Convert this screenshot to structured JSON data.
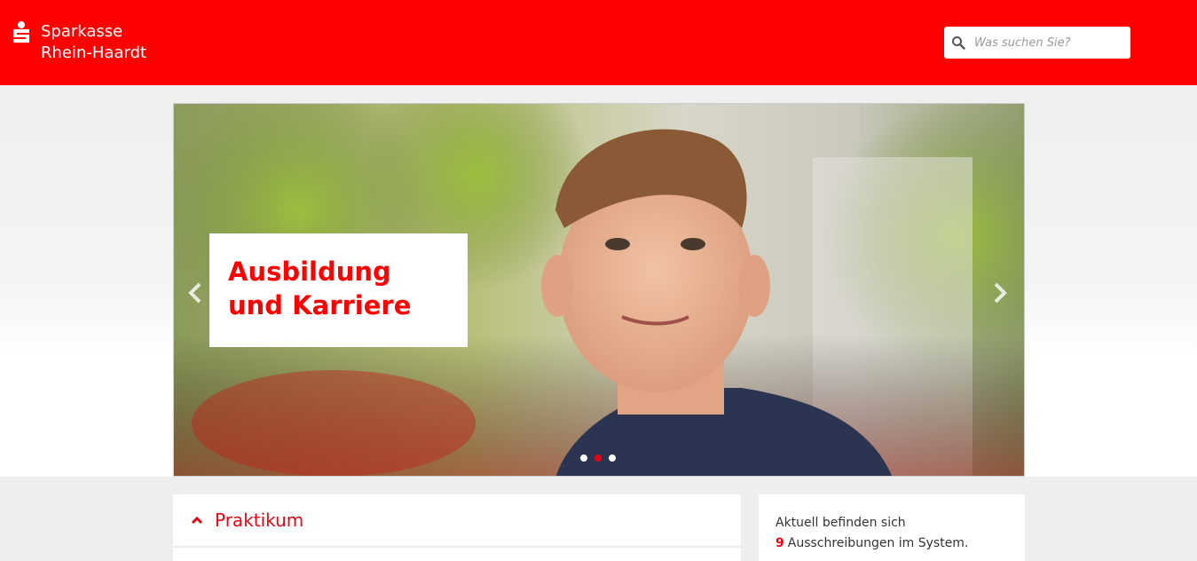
{
  "brand": {
    "line1": "Sparkasse",
    "line2": "Rhein-Haardt",
    "logo_icon": "sparkasse-s-icon",
    "color": "#ff0000"
  },
  "search": {
    "placeholder": "Was suchen Sie?",
    "value": "",
    "icon": "search-icon"
  },
  "hero": {
    "title": "Ausbildung und Karriere",
    "prev_icon": "chevron-left-icon",
    "next_icon": "chevron-right-icon",
    "slides_count": 3,
    "active_slide": 2
  },
  "accordion": {
    "title": "Praktikum",
    "icon": "chevron-up-icon",
    "accent": "#e30613"
  },
  "info": {
    "line1": "Aktuell befinden sich",
    "count": "9",
    "line2": "Ausschreibungen im System."
  }
}
